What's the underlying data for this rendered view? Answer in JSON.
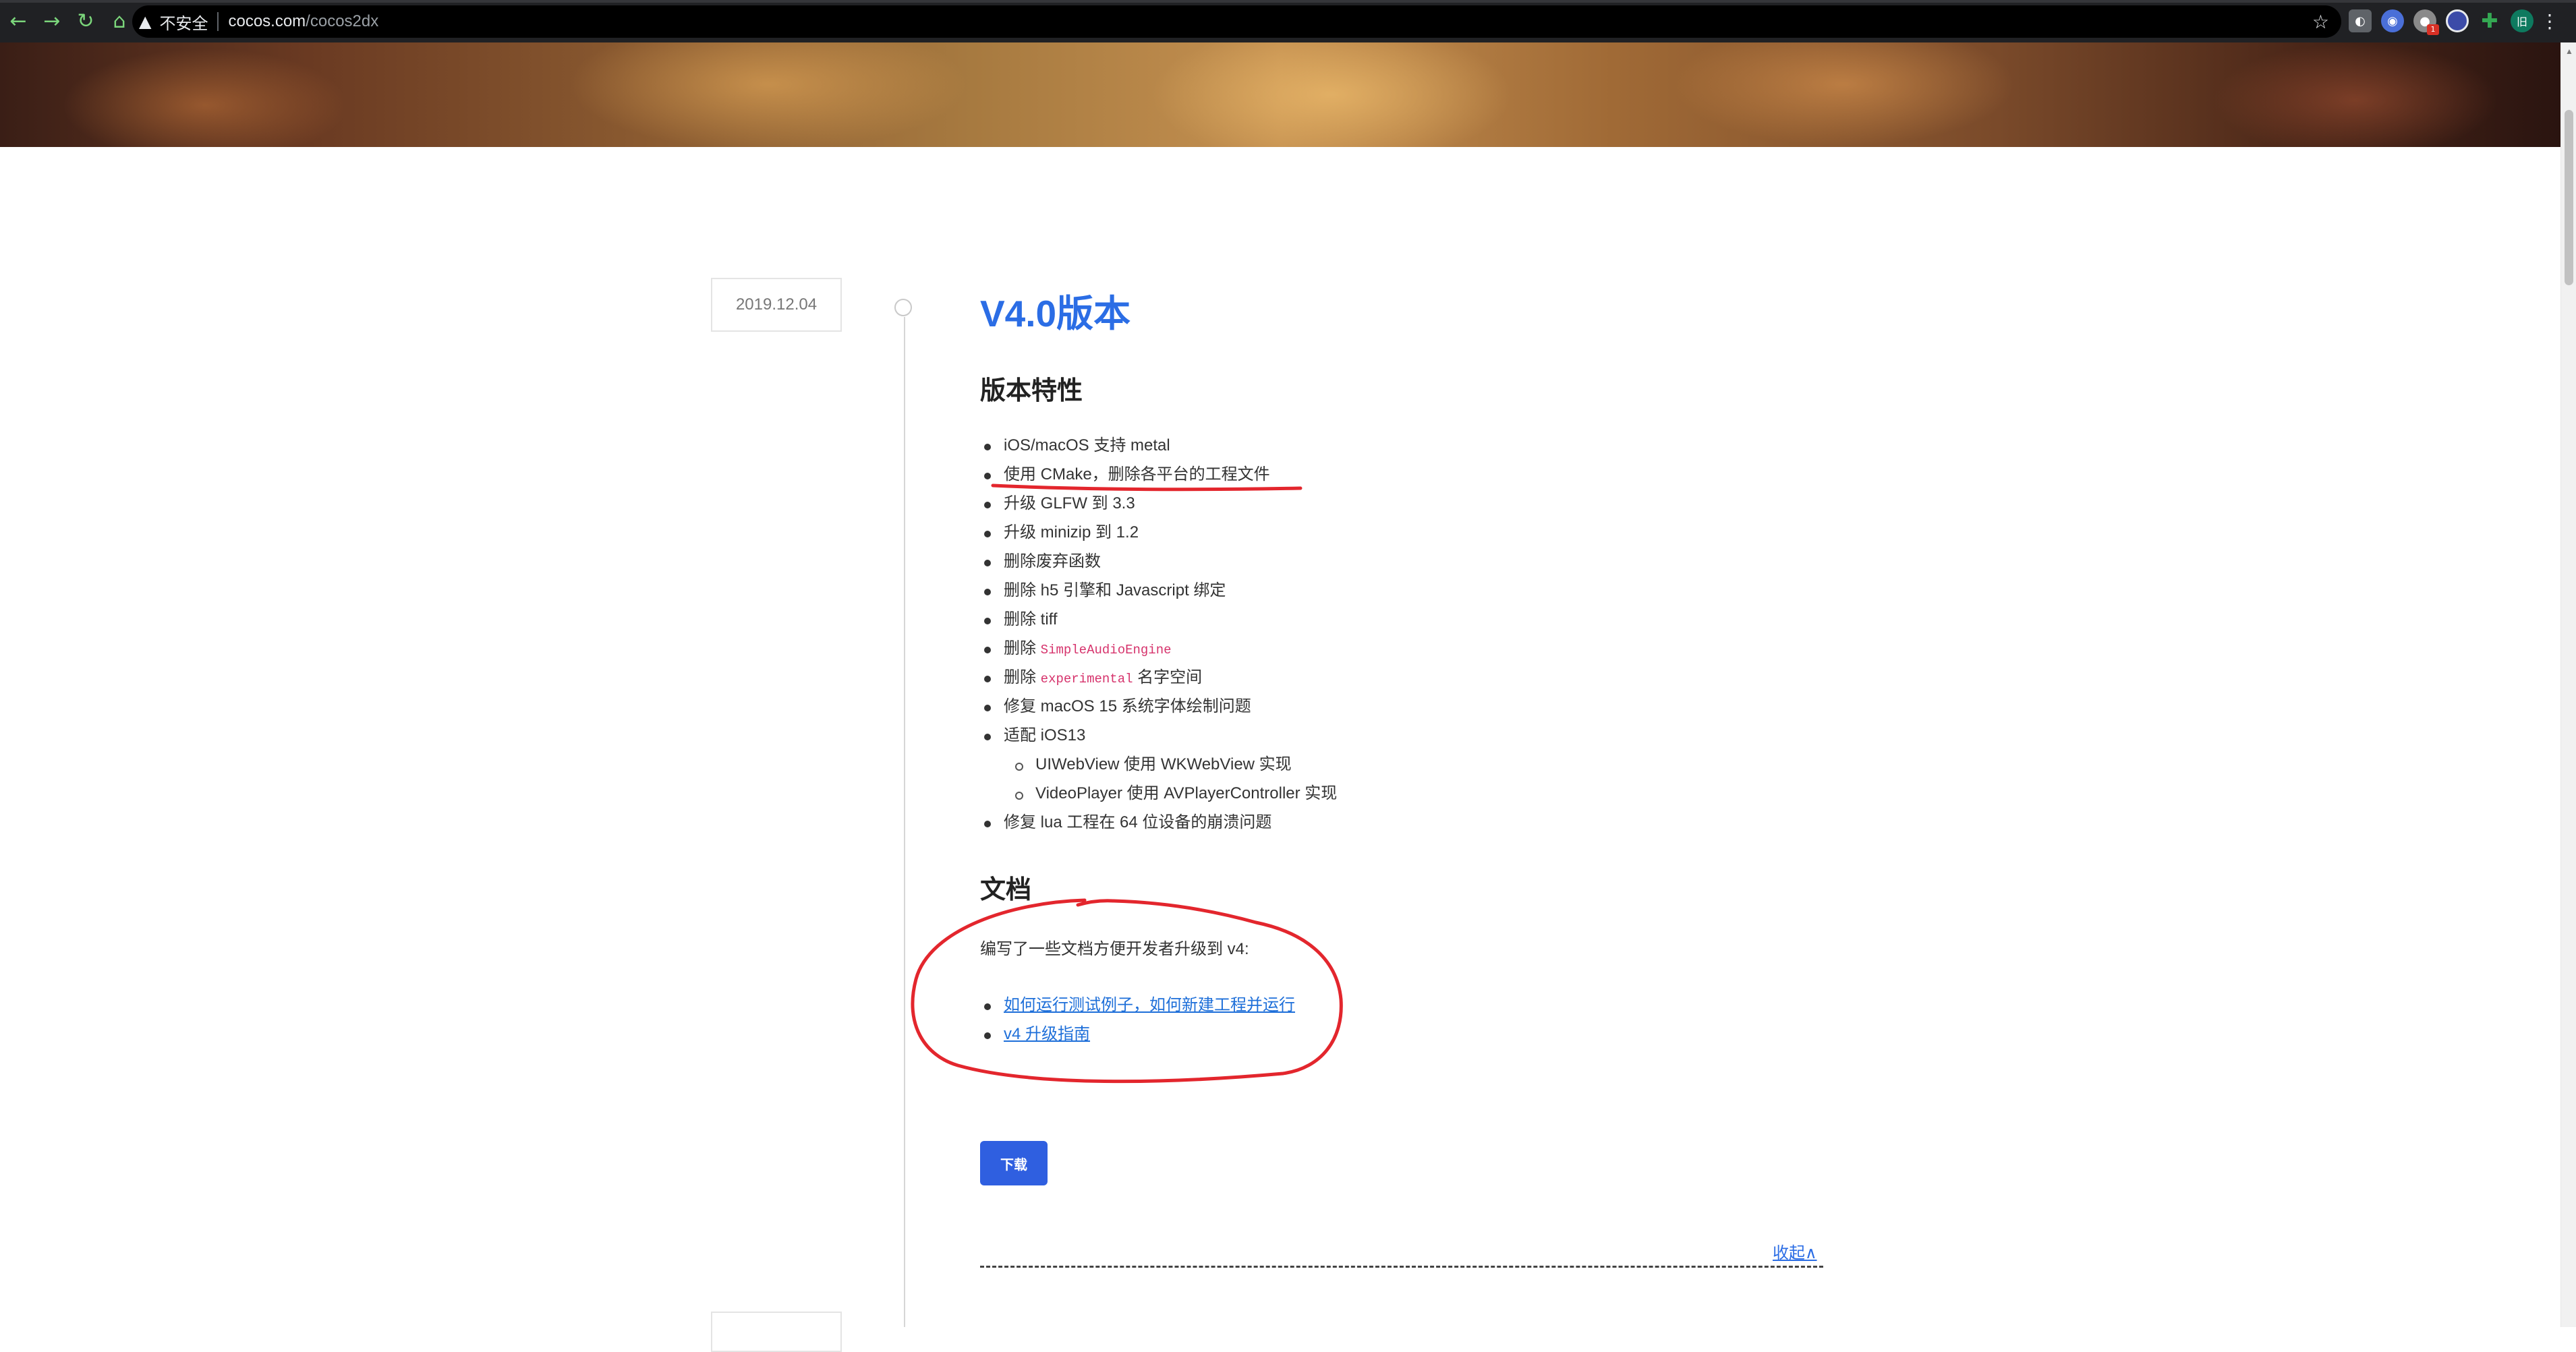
{
  "browser": {
    "security_label": "不安全",
    "url_host": "cocos.com",
    "url_path": "/cocos2dx",
    "nav_icons": [
      "back-arrow-icon",
      "forward-arrow-icon",
      "reload-icon",
      "home-icon"
    ],
    "extension_badge": "1",
    "profile_initial": "旧"
  },
  "timeline": {
    "date": "2019.12.04"
  },
  "release": {
    "title": "V4.0版本",
    "features_heading": "版本特性",
    "features": [
      {
        "text": "iOS/macOS 支持 metal"
      },
      {
        "text": "使用 CMake，删除各平台的工程文件"
      },
      {
        "text": "升级 GLFW 到 3.3"
      },
      {
        "text": "升级 minizip 到 1.2"
      },
      {
        "text": "删除废弃函数"
      },
      {
        "text": "删除 h5 引擎和 Javascript 绑定"
      },
      {
        "text": "删除 tiff"
      },
      {
        "prefix": "删除 ",
        "code": "SimpleAudioEngine",
        "suffix": ""
      },
      {
        "prefix": "删除 ",
        "code": "experimental",
        "suffix": " 名字空间"
      },
      {
        "text": "修复 macOS 15 系统字体绘制问题"
      },
      {
        "text": "适配 iOS13"
      },
      {
        "text": "UIWebView 使用 WKWebView 实现"
      },
      {
        "text": "VideoPlayer 使用 AVPlayerController 实现"
      },
      {
        "text": "修复 lua 工程在 64 位设备的崩溃问题"
      }
    ],
    "docs_heading": "文档",
    "docs_intro": "编写了一些文档方便开发者升级到 v4:",
    "doc_links": [
      "如何运行测试例子，如何新建工程并运行",
      "v4 升级指南"
    ],
    "download_label": "下载",
    "collapse_label": "收起∧"
  },
  "colors": {
    "accent": "#2b6de5",
    "link": "#1e6fd9",
    "button": "#2f5fe0",
    "annotation": "#e3262d",
    "code": "#d6336c"
  }
}
